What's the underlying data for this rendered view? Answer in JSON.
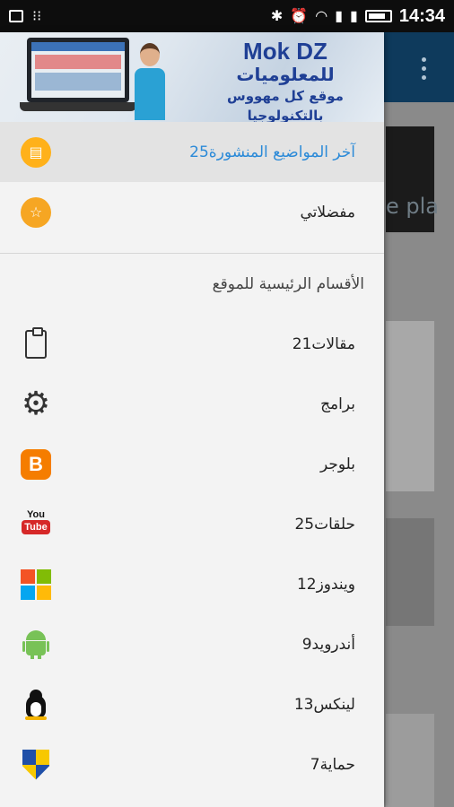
{
  "status_bar": {
    "time": "14:34",
    "icons": [
      "image-icon",
      "dialog-icon",
      "bluetooth-icon",
      "alarm-icon",
      "wifi-icon",
      "signal-icon",
      "signal-icon",
      "battery-icon"
    ]
  },
  "drawer": {
    "header": {
      "brand_title": "Mok DZ",
      "brand_subtitle": "للمعلوميات",
      "brand_tagline": "موقع كل مهووس بالتكنولوجيا"
    },
    "top_items": [
      {
        "label": "آخر المواضيع المنشورة",
        "count": "25",
        "icon": "feed-icon",
        "active": true
      },
      {
        "label": "مفضلاتي",
        "count": "",
        "icon": "star-icon",
        "active": false
      }
    ],
    "section_title": "الأقسام الرئيسية للموقع",
    "categories": [
      {
        "label": "مقالات",
        "count": "21",
        "icon": "clipboard-icon"
      },
      {
        "label": "برامج",
        "count": "",
        "icon": "gear-icon"
      },
      {
        "label": "بلوجر",
        "count": "",
        "icon": "blogger-icon"
      },
      {
        "label": "حلقات",
        "count": "25",
        "icon": "youtube-icon"
      },
      {
        "label": "ويندوز",
        "count": "12",
        "icon": "windows-icon"
      },
      {
        "label": "أندرويد",
        "count": "9",
        "icon": "android-icon"
      },
      {
        "label": "لينكس",
        "count": "13",
        "icon": "linux-icon"
      },
      {
        "label": "حماية",
        "count": "7",
        "icon": "shield-icon"
      }
    ]
  },
  "background": {
    "word_1": "e pla"
  },
  "colors": {
    "accent_blue": "#2b8ad8",
    "orange": "#ffb11a",
    "brand_blue": "#1f3f95"
  }
}
